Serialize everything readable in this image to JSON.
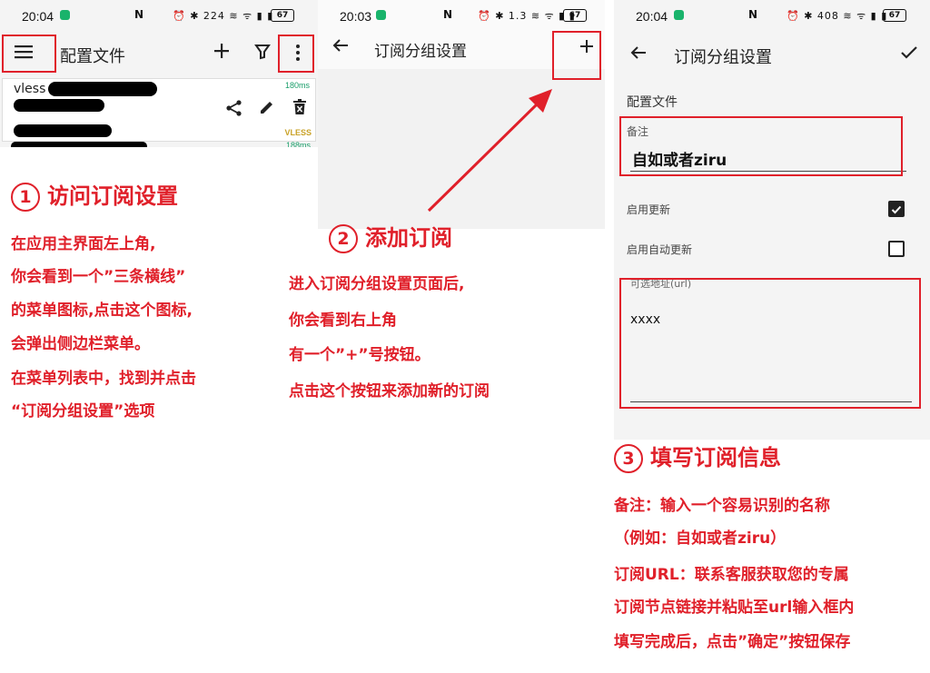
{
  "panel1": {
    "status": {
      "time": "20:04",
      "nfc": "N",
      "icons": "⏰ ✱ 224 ≋ ᯤ ▮ ▮",
      "battery": "67"
    },
    "title": "配置文件",
    "card": {
      "protocol_prefix": "vless",
      "latency_top": "180ms",
      "type": "VLESS",
      "latency_bottom": "188ms"
    }
  },
  "panel2": {
    "status": {
      "time": "20:03",
      "nfc": "N",
      "icons": "⏰ ✱ 1.3 ≋ ᯤ ▮ ▮",
      "battery": "67"
    },
    "title": "订阅分组设置"
  },
  "panel3": {
    "status": {
      "time": "20:04",
      "nfc": "N",
      "icons": "⏰ ✱ 408 ≋ ᯤ ▮ ▮",
      "battery": "67"
    },
    "title": "订阅分组设置",
    "section_label": "配置文件",
    "remark_label": "备注",
    "remark_value": "自如或者ziru",
    "enable_update_label": "启用更新",
    "enable_update_checked": true,
    "enable_auto_update_label": "启用自动更新",
    "enable_auto_update_checked": false,
    "url_label": "可选地址(url)",
    "url_value": "xxxx"
  },
  "step1": {
    "number": "1",
    "title": "访问订阅设置",
    "lines": [
      "在应用主界面左上角,",
      "你会看到一个”三条横线”",
      "的菜单图标,点击这个图标,",
      "会弹出侧边栏菜单。",
      "在菜单列表中，找到并点击",
      "“订阅分组设置”选项"
    ]
  },
  "step2": {
    "number": "2",
    "title": "添加订阅",
    "lines": [
      "进入订阅分组设置页面后,",
      "你会看到右上角",
      "有一个”+”号按钮。",
      "点击这个按钮来添加新的订阅"
    ]
  },
  "step3": {
    "number": "3",
    "title": "填写订阅信息",
    "lines": [
      "备注：输入一个容易识别的名称",
      "（例如：自如或者ziru）",
      "订阅URL：联系客服获取您的专属",
      "订阅节点链接并粘贴至url输入框内",
      "填写完成后，点击”确定”按钮保存"
    ]
  },
  "colors": {
    "annotation_red": "#e0202a",
    "latency_green": "#1a9e6a",
    "vless_gold": "#c9a227"
  }
}
